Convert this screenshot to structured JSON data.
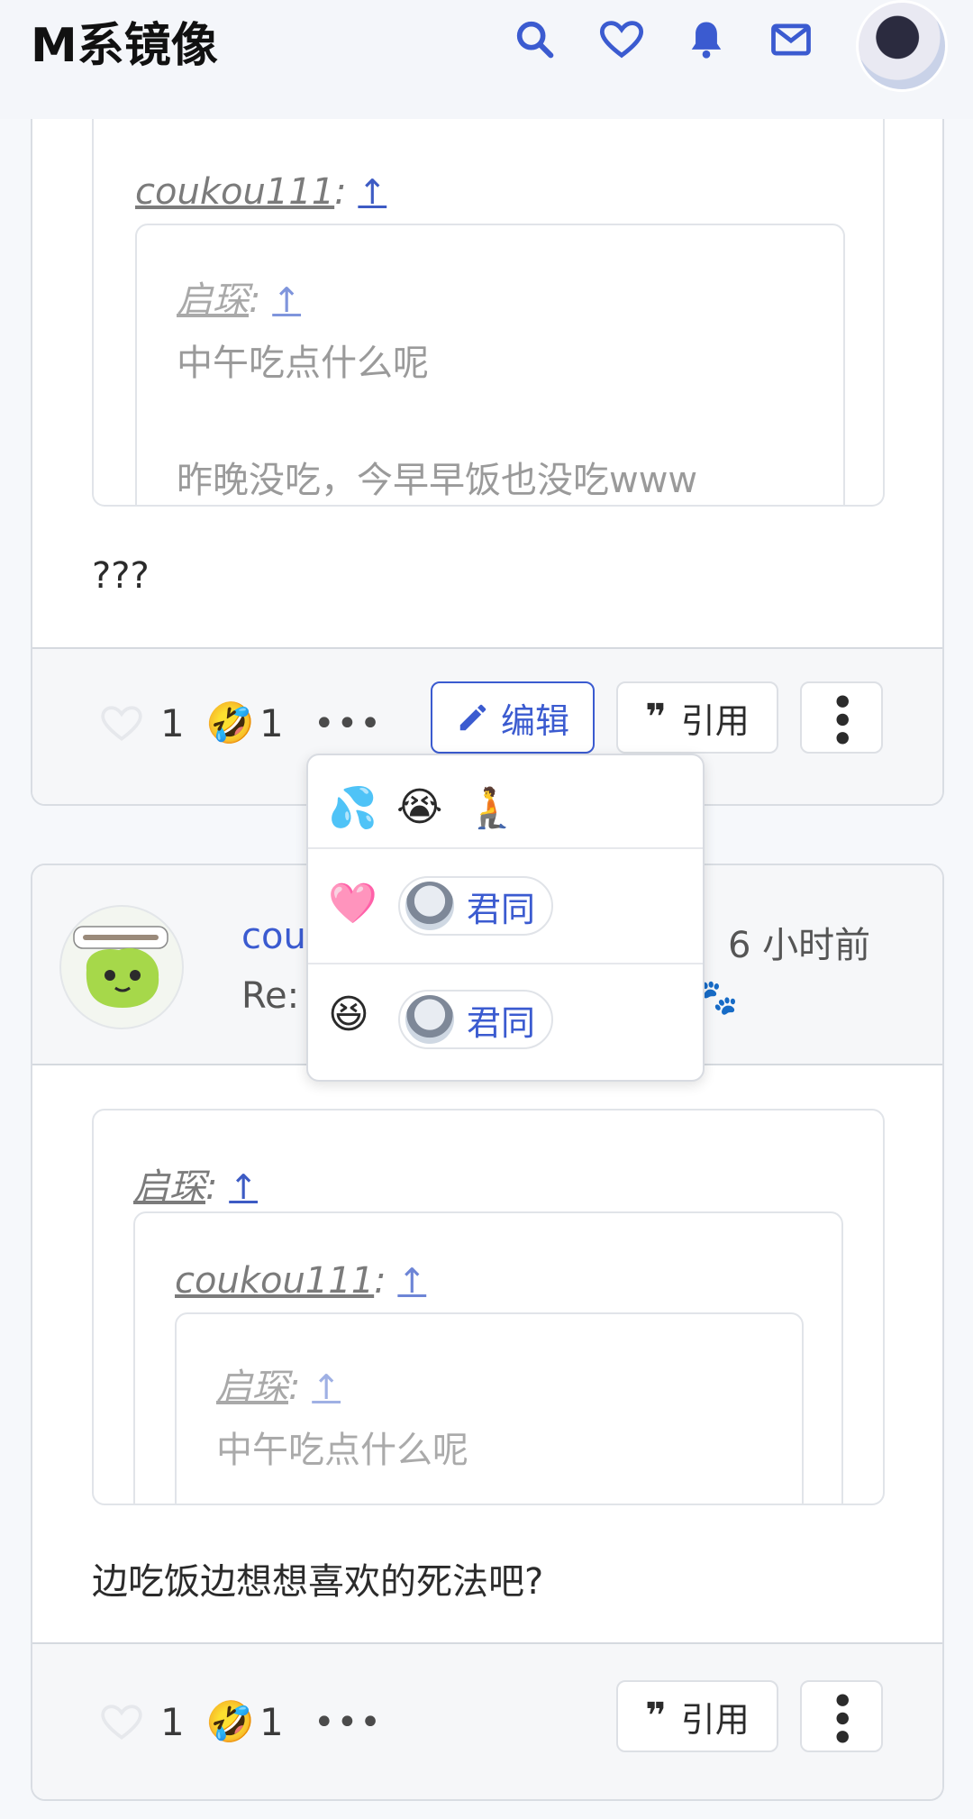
{
  "header": {
    "brand": "M系镜像",
    "icons": [
      "search-icon",
      "heart-icon",
      "bell-icon",
      "mail-icon"
    ]
  },
  "post1": {
    "outer_quote": {
      "author": "coukou111",
      "arrow": "↑"
    },
    "inner_quote": {
      "author": "启琛",
      "arrow": "↑",
      "line1": "中午吃点什么呢",
      "line2": "昨晚没吃，今早早饭也没吃www"
    },
    "text": "???",
    "footer": {
      "likes": "1",
      "reaction_count": "1",
      "more": "•••",
      "edit_label": "编辑",
      "quote_label": "引用"
    }
  },
  "popup": {
    "emojis": [
      "💦",
      "😭",
      "🧎"
    ],
    "row1": {
      "emoji": "🩷",
      "user": "君同"
    },
    "row2": {
      "emoji": "😆",
      "user": "君同"
    }
  },
  "post2": {
    "author_partial": "cou",
    "subject_partial": "Re:",
    "time": "6 小时前",
    "paw": "🐾",
    "quote_l1": {
      "author": "启琛",
      "arrow": "↑"
    },
    "quote_l2": {
      "author": "coukou111",
      "arrow": "↑"
    },
    "quote_l3": {
      "author": "启琛",
      "arrow": "↑",
      "line1": "中午吃点什么呢"
    },
    "text": "边吃饭边想想喜欢的死法吧?",
    "footer": {
      "likes": "1",
      "reaction_count": "1",
      "more": "•••",
      "quote_label": "引用"
    }
  },
  "colors": {
    "accent": "#3b5bd0",
    "border": "#d9dde3",
    "footer_bg": "#f6f7f9"
  }
}
